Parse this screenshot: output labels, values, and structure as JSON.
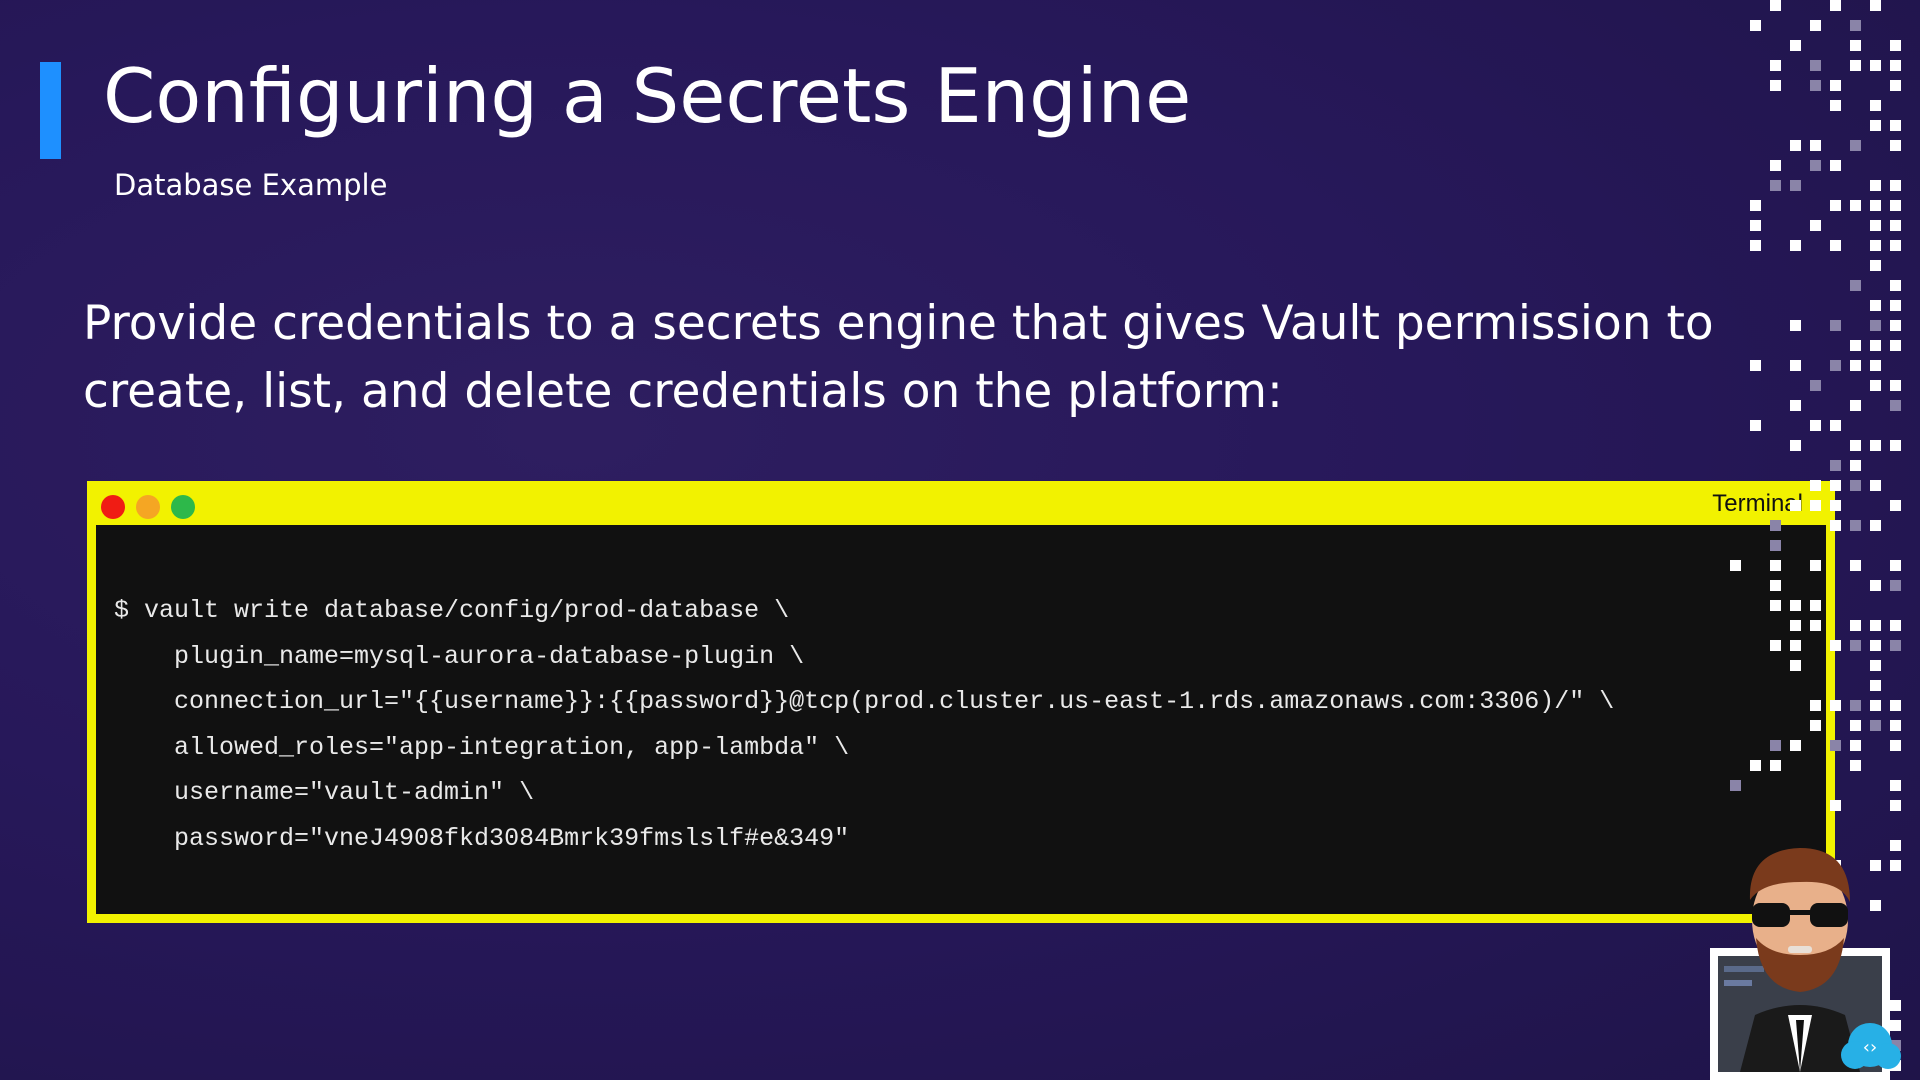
{
  "slide": {
    "title": "Configuring a Secrets Engine",
    "subtitle": "Database Example",
    "body": "Provide credentials to a secrets engine that gives Vault permission to create, list, and delete credentials on the platform:"
  },
  "terminal": {
    "title": "Terminal",
    "code_lines": [
      "$ vault write database/config/prod-database \\",
      "    plugin_name=mysql-aurora-database-plugin \\",
      "    connection_url=\"{{username}}:{{password}}@tcp(prod.cluster.us-east-1.rds.amazonaws.com:3306)/\" \\",
      "    allowed_roles=\"app-integration, app-lambda\" \\",
      "    username=\"vault-admin\" \\",
      "    password=\"vneJ4908fkd3084Bmrk39fmslslf#e&349\""
    ]
  },
  "colors": {
    "background": "#27185a",
    "accent": "#1e90ff",
    "terminal_frame": "#f2f200",
    "terminal_bg": "#111111"
  }
}
